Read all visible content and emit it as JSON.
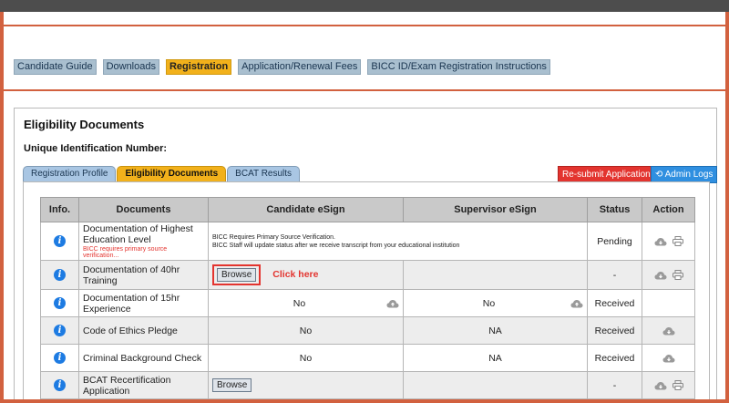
{
  "topnav": {
    "tabs": [
      {
        "label": "Candidate Guide"
      },
      {
        "label": "Downloads"
      },
      {
        "label": "Registration",
        "active": true
      },
      {
        "label": "Application/Renewal Fees"
      },
      {
        "label": "BICC ID/Exam Registration Instructions"
      }
    ]
  },
  "panel": {
    "title": "Eligibility Documents",
    "uid_label": "Unique Identification Number:",
    "subtabs": [
      {
        "label": "Registration Profile"
      },
      {
        "label": "Eligibility Documents",
        "active": true
      },
      {
        "label": "BCAT Results"
      }
    ],
    "resubmit_label": "Re-submit Application",
    "adminlogs_label": "Admin Logs"
  },
  "table": {
    "headers": [
      "Info.",
      "Documents",
      "Candidate eSign",
      "Supervisor eSign",
      "Status",
      "Action"
    ],
    "rows": [
      {
        "document": "Documentation of Highest Education Level",
        "warning": "BICC requires primary source verification...",
        "esign_note_1": "BICC Requires Primary Source Verification.",
        "esign_note_2": "BICC Staff will update status after we receive transcript from your educational institution",
        "status": "Pending"
      },
      {
        "document": "Documentation of 40hr Training",
        "browse_label": "Browse",
        "click_here": "Click here",
        "status": "-"
      },
      {
        "document": "Documentation of 15hr Experience",
        "candidate": "No",
        "supervisor": "No",
        "status": "Received"
      },
      {
        "document": "Code of Ethics Pledge",
        "candidate": "No",
        "supervisor": "NA",
        "status": "Received"
      },
      {
        "document": "Criminal Background Check",
        "candidate": "No",
        "supervisor": "NA",
        "status": "Received"
      },
      {
        "document": "BCAT Recertification Application",
        "browse_label": "Browse",
        "status": "-"
      }
    ]
  },
  "colors": {
    "accent_orange": "#d2613f",
    "active_tab": "#f2b11b",
    "info_blue": "#1d7be2",
    "alert_red": "#e3342f"
  }
}
